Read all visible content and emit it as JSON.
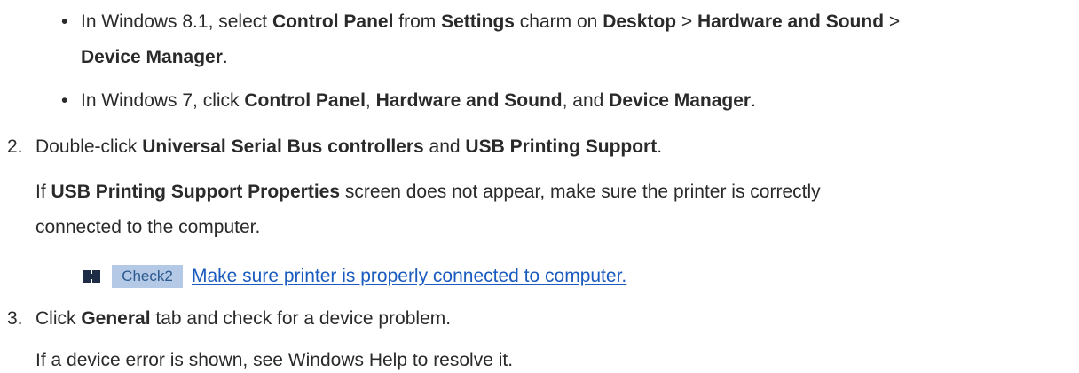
{
  "bullet_char": "•",
  "lines": {
    "l1": {
      "p1": "In Windows 8.1, select ",
      "b1": "Control Panel",
      "p2": " from ",
      "b2": "Settings",
      "p3": " charm on ",
      "b3": "Desktop",
      "p4": " > ",
      "b4": "Hardware and Sound",
      "p5": " >"
    },
    "l2": {
      "b1": "Device Manager",
      "p1": "."
    },
    "l3": {
      "p1": "In Windows 7, click ",
      "b1": "Control Panel",
      "p2": ", ",
      "b2": "Hardware and Sound",
      "p3": ", and ",
      "b3": "Device Manager",
      "p4": "."
    },
    "l4": {
      "num": "2.",
      "p1": "Double-click ",
      "b1": "Universal Serial Bus controllers",
      "p2": " and ",
      "b2": "USB Printing Support",
      "p3": "."
    },
    "l5": {
      "p1": "If ",
      "b1": "USB Printing Support Properties",
      "p2": " screen does not appear, make sure the printer is correctly"
    },
    "l6": {
      "p1": "connected to the computer."
    },
    "l8": {
      "num": "3.",
      "p1": "Click ",
      "b1": "General",
      "p2": " tab and check for a device problem."
    },
    "l9": {
      "p1": "If a device error is shown, see Windows Help to resolve it."
    }
  },
  "check_link": {
    "icon": "reference-icon",
    "badge": "Check2",
    "text": "Make sure printer is properly connected to computer."
  },
  "colors": {
    "text": "#2a2a2a",
    "link": "#1a5bbf",
    "badge_bg": "#b3c9e6",
    "badge_text": "#2d5a8e",
    "icon": "#1e2c46"
  }
}
